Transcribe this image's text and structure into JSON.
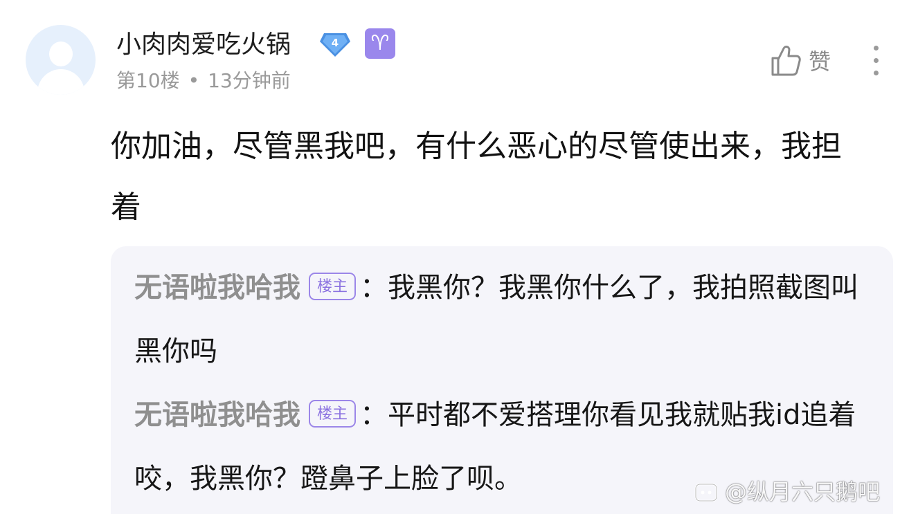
{
  "post": {
    "username": "小肉肉爱吃火锅",
    "level": "4",
    "zodiac_symbol": "♈",
    "floor": "第10楼",
    "meta_separator": "•",
    "time": "13分钟前",
    "like_label": "赞",
    "content": "你加油，尽管黑我吧，有什么恶心的尽管使出来，我担着"
  },
  "replies": [
    {
      "author": "无语啦我哈我",
      "tag": "楼主",
      "colon": "：",
      "text": "我黑你？我黑你什么了，我拍照截图叫黑你吗"
    },
    {
      "author": "无语啦我哈我",
      "tag": "楼主",
      "colon": "：",
      "text": "平时都不爱搭理你看见我就贴我id追着咬，我黑你？蹬鼻子上脸了呗。"
    }
  ],
  "watermark": "@纵月六只鹅吧",
  "colors": {
    "level_badge": "#4a90e2",
    "zodiac_badge": "#9a87ec",
    "op_tag": "#8b72e0",
    "reply_bg": "#f5f5fa"
  }
}
